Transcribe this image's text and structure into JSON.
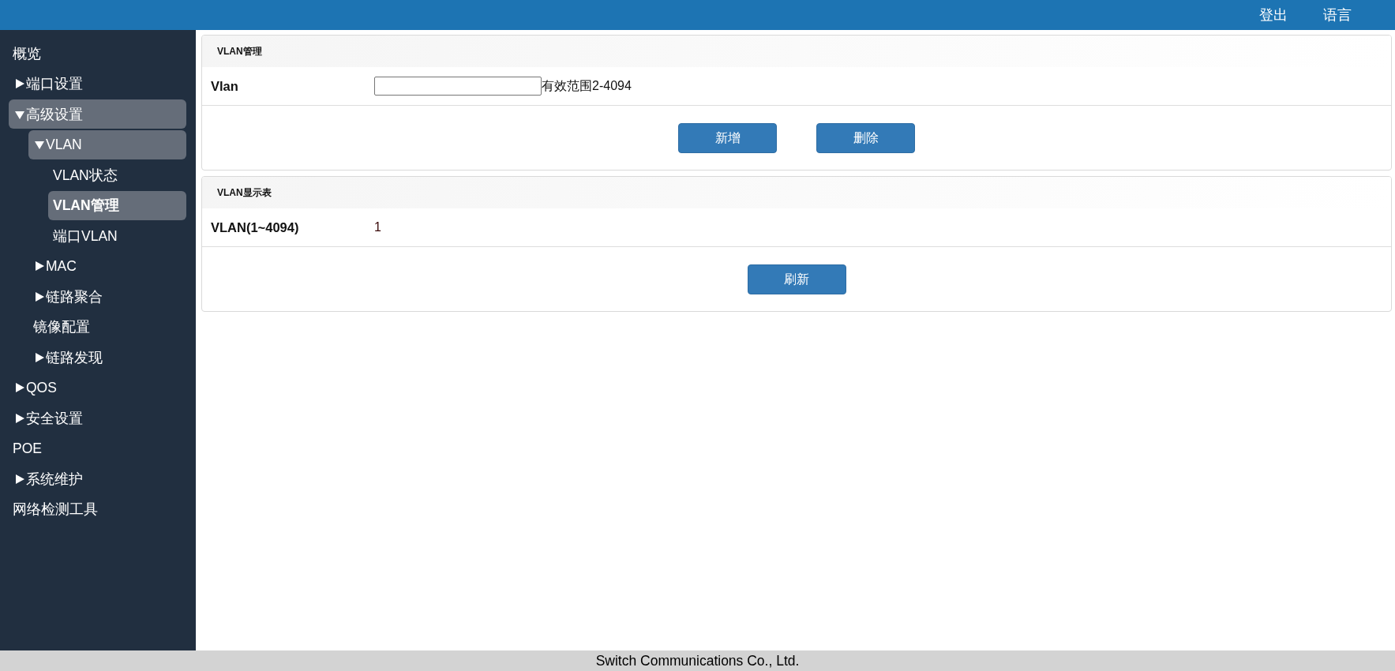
{
  "top_bar": {
    "links": [
      "登出",
      "语言"
    ]
  },
  "sidebar": {
    "items": [
      {
        "label": "概览",
        "active": false,
        "selected": false
      },
      {
        "label": "端口设置",
        "expanded": false,
        "active": false,
        "selected": false
      },
      {
        "label": "高级设置",
        "expanded": true,
        "active": true,
        "selected": false,
        "children": [
          {
            "label": "VLAN",
            "expanded": true,
            "active": true,
            "selected": false,
            "children": [
              {
                "label": "VLAN状态",
                "active": false,
                "selected": false
              },
              {
                "label": "VLAN管理",
                "active": true,
                "selected": true
              },
              {
                "label": "端口VLAN",
                "active": false,
                "selected": false
              }
            ]
          },
          {
            "label": "MAC",
            "expanded": false,
            "active": false,
            "selected": false
          },
          {
            "label": "链路聚合",
            "expanded": false,
            "active": false,
            "selected": false
          },
          {
            "label": "镜像配置",
            "active": false,
            "selected": false
          },
          {
            "label": "链路发现",
            "expanded": false,
            "active": false,
            "selected": false
          }
        ]
      },
      {
        "label": "QOS",
        "expanded": false,
        "active": false,
        "selected": false
      },
      {
        "label": "安全设置",
        "expanded": false,
        "active": false,
        "selected": false
      },
      {
        "label": "POE",
        "active": false,
        "selected": false
      },
      {
        "label": "系统维护",
        "expanded": false,
        "active": false,
        "selected": false
      },
      {
        "label": "网络检测工具",
        "active": false,
        "selected": false
      }
    ]
  },
  "panels": [
    {
      "title": "VLAN管理",
      "rows": [
        {
          "kind": "input",
          "label": "Vlan",
          "value": "",
          "hint": "有效范围2-4094"
        }
      ],
      "buttons": [
        "新增",
        "删除"
      ]
    },
    {
      "title": "VLAN显示表",
      "rows": [
        {
          "kind": "text",
          "label": "VLAN(1~4094)",
          "value": "1"
        }
      ],
      "buttons": [
        "刷新"
      ]
    }
  ],
  "footer": {
    "text": "Switch Communications Co., Ltd."
  }
}
